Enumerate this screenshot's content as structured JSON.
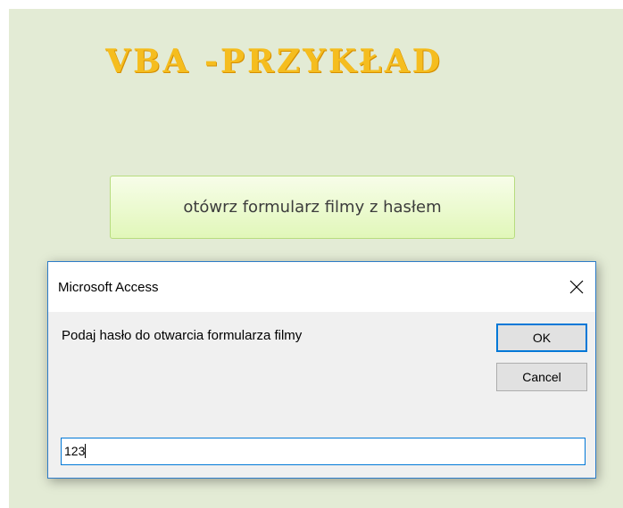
{
  "form": {
    "title": "VBA -PRZYKŁAD",
    "open_button_label": "otówrz formularz filmy z hasłem",
    "title_color": "#f5bd1f",
    "background_color": "#e3ebd5"
  },
  "dialog": {
    "title": "Microsoft Access",
    "prompt": "Podaj hasło do otwarcia formularza filmy",
    "ok_label": "OK",
    "cancel_label": "Cancel",
    "input_value": "123",
    "close_icon": "close-icon",
    "accent_color": "#0078d7"
  }
}
